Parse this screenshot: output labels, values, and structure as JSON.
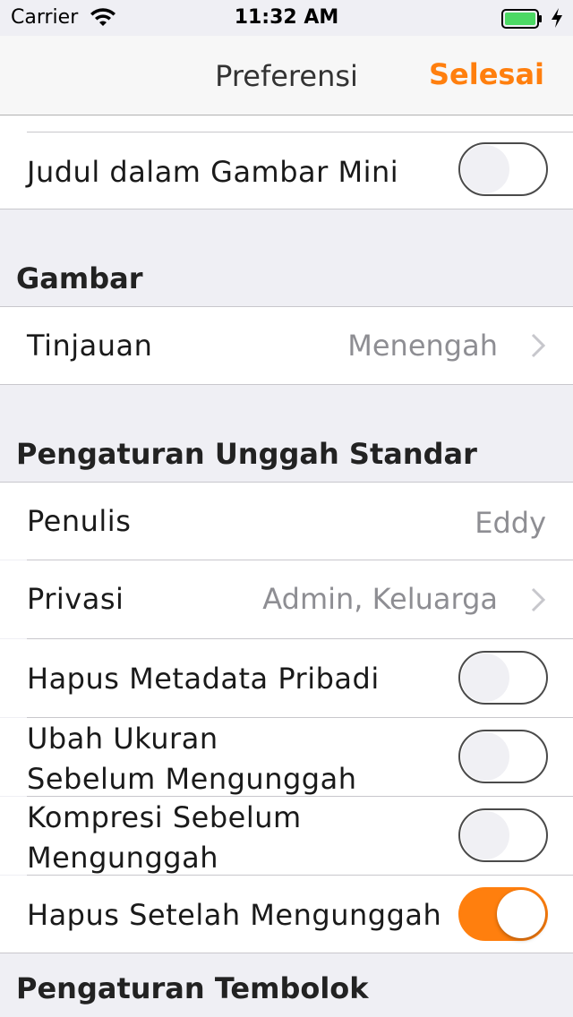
{
  "status_bar": {
    "carrier": "Carrier",
    "time": "11:32 AM"
  },
  "nav": {
    "title": "Preferensi",
    "done_label": "Selesai"
  },
  "thumbnail_title": {
    "label": "Judul dalam Gambar Mini",
    "enabled": false
  },
  "images_section": {
    "header": "Gambar",
    "preview": {
      "label": "Tinjauan",
      "value": "Menengah"
    }
  },
  "upload_section": {
    "header": "Pengaturan Unggah Standar",
    "author": {
      "label": "Penulis",
      "value": "Eddy"
    },
    "privacy": {
      "label": "Privasi",
      "value": "Admin, Keluarga"
    },
    "strip_metadata": {
      "label": "Hapus Metadata Pribadi",
      "enabled": false
    },
    "resize": {
      "label_line1": "Ubah Ukuran",
      "label_line2": "Sebelum Mengunggah",
      "enabled": false
    },
    "compress": {
      "label_line1": "Kompresi Sebelum",
      "label_line2": "Mengunggah",
      "enabled": false
    },
    "delete_after": {
      "label": "Hapus Setelah Mengunggah",
      "enabled": true
    }
  },
  "cache_section": {
    "header": "Pengaturan Tembolok"
  },
  "colors": {
    "accent": "#ff7f0e",
    "background": "#efeff4"
  }
}
